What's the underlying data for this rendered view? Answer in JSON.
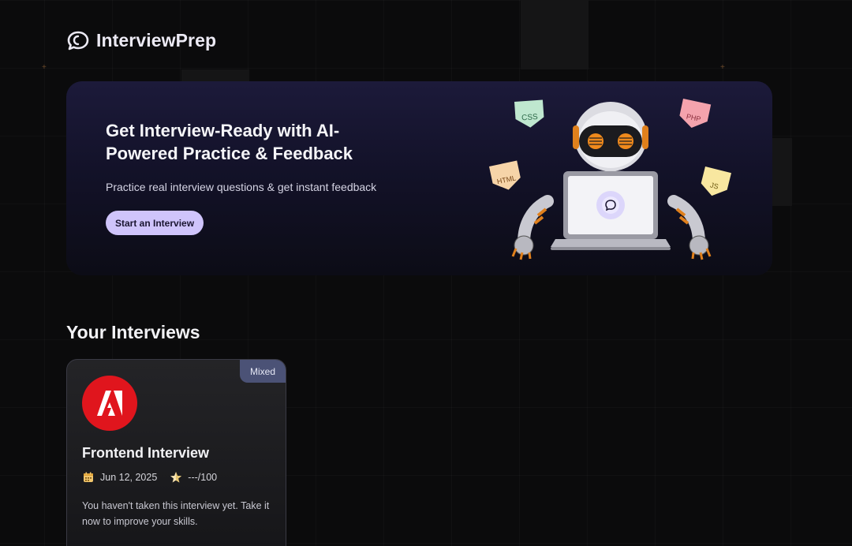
{
  "app": {
    "name": "InterviewPrep"
  },
  "hero": {
    "title": "Get Interview-Ready with AI-Powered Practice & Feedback",
    "subtitle": "Practice real interview questions & get instant feedback",
    "cta_label": "Start an Interview",
    "tags": [
      "CSS",
      "PHP",
      "HTML",
      "JS"
    ]
  },
  "interviews": {
    "section_title": "Your Interviews",
    "items": [
      {
        "type_badge": "Mixed",
        "company_logo": "adobe-logo",
        "title": "Frontend Interview",
        "date": "Jun 12, 2025",
        "score": "---/100",
        "description": "You haven't taken this interview yet. Take it now to improve your skills."
      }
    ]
  },
  "colors": {
    "accent": "#cfc4fb",
    "badge": "#4b5276",
    "adobe_red": "#e0151d",
    "background": "#0b0b0c"
  }
}
